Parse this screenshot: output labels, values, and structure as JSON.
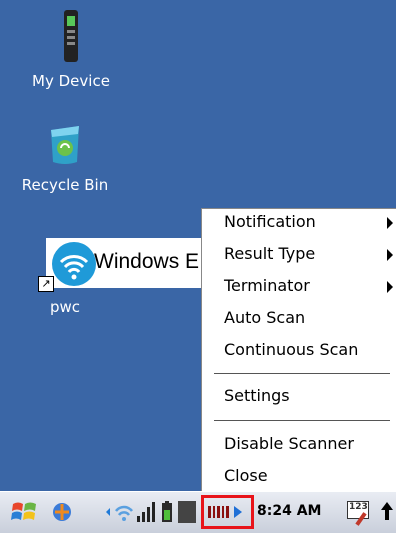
{
  "desktop": {
    "icons": [
      {
        "label": "My Device",
        "icon": "handheld-device-icon"
      },
      {
        "label": "Recycle Bin",
        "icon": "recycle-bin-icon"
      },
      {
        "label": "pwc",
        "icon": "wifi-shortcut-icon"
      }
    ],
    "banner_text": "Windows E"
  },
  "context_menu": {
    "items": [
      {
        "label": "Notification",
        "submenu": true
      },
      {
        "label": "Result Type",
        "submenu": true
      },
      {
        "label": "Terminator",
        "submenu": true
      },
      {
        "label": "Auto Scan",
        "submenu": false
      },
      {
        "label": "Continuous Scan",
        "submenu": false
      },
      {
        "label": "Settings",
        "submenu": false
      },
      {
        "label": "Disable Scanner",
        "submenu": false
      },
      {
        "label": "Close",
        "submenu": false
      }
    ]
  },
  "taskbar": {
    "start_icon": "windows-flag-icon",
    "tray_icons": [
      "connections-icon",
      "wifi-icon",
      "signal-bars-icon",
      "battery-icon",
      "barcode-scanner-icon"
    ],
    "clock": "8:24 AM",
    "input_panel_label": "123",
    "highlight_color": "#e8141a"
  }
}
